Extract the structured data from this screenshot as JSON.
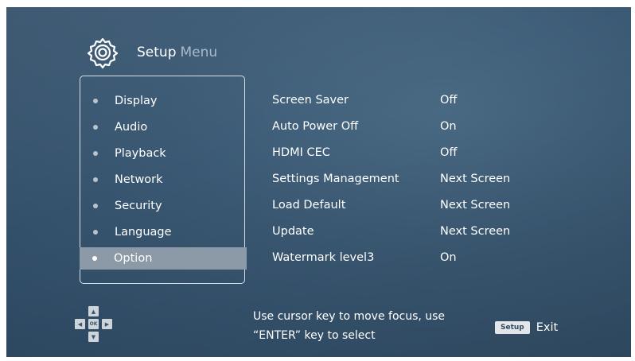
{
  "header": {
    "title_strong": "Setup",
    "title_light": "Menu",
    "icon": "gear-icon"
  },
  "sidebar": {
    "items": [
      {
        "label": "Display"
      },
      {
        "label": "Audio"
      },
      {
        "label": "Playback"
      },
      {
        "label": "Network"
      },
      {
        "label": "Security"
      },
      {
        "label": "Language"
      },
      {
        "label": "Option"
      }
    ],
    "selected": "Option"
  },
  "options": [
    {
      "label": "Screen Saver",
      "value": "Off"
    },
    {
      "label": "Auto Power Off",
      "value": "On"
    },
    {
      "label": "HDMI CEC",
      "value": "Off"
    },
    {
      "label": "Settings Management",
      "value": "Next Screen"
    },
    {
      "label": "Load Default",
      "value": "Next Screen"
    },
    {
      "label": "Update",
      "value": "Next Screen"
    },
    {
      "label": "Watermark level3",
      "value": "On"
    }
  ],
  "footer": {
    "dpad_ok": "OK",
    "help_line1": "Use cursor key to move focus, use",
    "help_line2": "“ENTER” key to select",
    "setup_key": "Setup",
    "exit_label": "Exit"
  },
  "colors": {
    "background": "#3a5873",
    "selected_row": "#8b9aa6",
    "panel_border": "#d7e0e8"
  }
}
